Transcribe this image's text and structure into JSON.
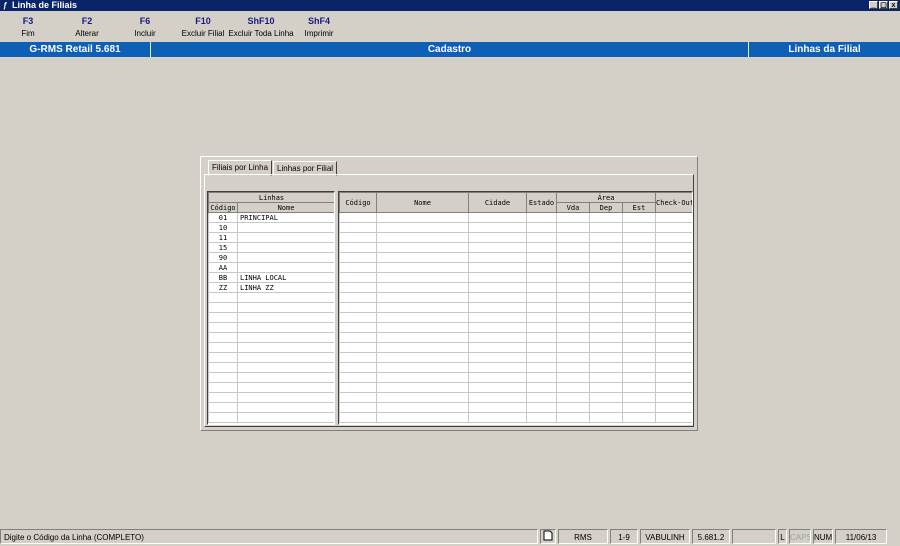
{
  "window": {
    "title": "Linha de Filiais",
    "buttons": [
      "_",
      "▢",
      "x"
    ]
  },
  "toolbar": [
    {
      "key": "F3",
      "label": "Fim"
    },
    {
      "key": "F2",
      "label": "Alterar"
    },
    {
      "key": "F6",
      "label": "Incluir"
    },
    {
      "key": "F10",
      "label": "Excluir Filial"
    },
    {
      "key": "ShF10",
      "label": "Excluir Toda Linha"
    },
    {
      "key": "ShF4",
      "label": "Imprimir"
    }
  ],
  "infobar": {
    "app": "G-RMS Retail 5.681",
    "section": "Cadastro",
    "screen": "Linhas da Filial"
  },
  "tabs": [
    "Filiais por Linha",
    "Linhas por Filial"
  ],
  "lines_grid": {
    "group_header": "Linhas",
    "columns": [
      "Código",
      "Nome"
    ],
    "rows": [
      [
        "01",
        "PRINCIPAL"
      ],
      [
        "10",
        ""
      ],
      [
        "11",
        ""
      ],
      [
        "15",
        ""
      ],
      [
        "90",
        ""
      ],
      [
        "AA",
        ""
      ],
      [
        "BB",
        "LINHA LOCAL"
      ],
      [
        "ZZ",
        "LINHA ZZ"
      ]
    ]
  },
  "branches_grid": {
    "columns": [
      "Código",
      "Nome",
      "Cidade",
      "Estado"
    ],
    "area_header": "Área",
    "area_columns": [
      "Vda",
      "Dep",
      "Est"
    ],
    "last_column": "Check-Out"
  },
  "statusbar": {
    "message": "Digite o Código da Linha (COMPLETO)",
    "user": "RMS",
    "range": "1-9",
    "program": "VABULINH",
    "version": "5.681.2",
    "blank": "",
    "l_flag": "L",
    "caps": "CAPS",
    "num": "NUM",
    "date": "11/06/13"
  }
}
